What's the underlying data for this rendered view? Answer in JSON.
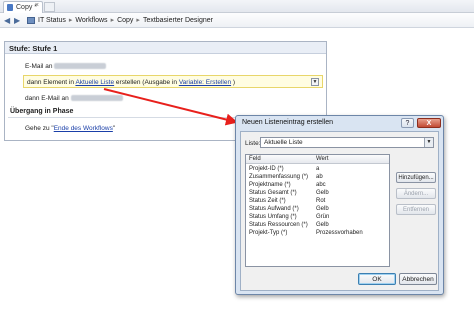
{
  "tabbar": {
    "doc_tab_label": "Copy *",
    "close_glyph": "×"
  },
  "breadcrumb": {
    "items": [
      "IT Status",
      "Workflows",
      "Copy",
      "Textbasierter Designer"
    ],
    "separator": "▸"
  },
  "stage": {
    "title": "Stufe: Stufe 1",
    "row1_prefix": "E-Mail an",
    "row2": {
      "prefix": "dann Element in",
      "list_link": "Aktuelle Liste",
      "middle": "erstellen (Ausgabe in",
      "var_link": "Variable: Erstellen",
      "suffix": ")"
    },
    "row3_prefix": "dann E-Mail an",
    "transition_title": "Übergang in Phase",
    "goto_prefix": "Gehe zu",
    "goto_link": "Ende des Workflows",
    "goto_quote_open": "\"",
    "goto_quote_close": "\""
  },
  "dialog": {
    "title": "Neuen Listeneintrag erstellen",
    "help_label": "?",
    "close_label": "X",
    "liste_label": "Liste:",
    "liste_value": "Aktuelle Liste",
    "columns": [
      "Feld",
      "Wert"
    ],
    "rows": [
      {
        "feld": "Projekt-ID (*)",
        "wert": "a"
      },
      {
        "feld": "Zusammenfassung (*)",
        "wert": "ab"
      },
      {
        "feld": "Projektname (*)",
        "wert": "abc"
      },
      {
        "feld": "Status Gesamt (*)",
        "wert": "Gelb"
      },
      {
        "feld": "Status Zeit (*)",
        "wert": "Rot"
      },
      {
        "feld": "Status Aufwand (*)",
        "wert": "Gelb"
      },
      {
        "feld": "Status Umfang (*)",
        "wert": "Grün"
      },
      {
        "feld": "Status Ressourcen (*)",
        "wert": "Gelb"
      },
      {
        "feld": "Projekt-Typ (*)",
        "wert": "Prozessvorhaben"
      }
    ],
    "add_label": "Hinzufügen...",
    "edit_label": "Ändern...",
    "remove_label": "Entfernen",
    "ok_label": "OK",
    "cancel_label": "Abbrechen"
  },
  "colors": {
    "arrow": "#e8201c",
    "highlight": "#fffde2",
    "link": "#1a3fa8"
  }
}
